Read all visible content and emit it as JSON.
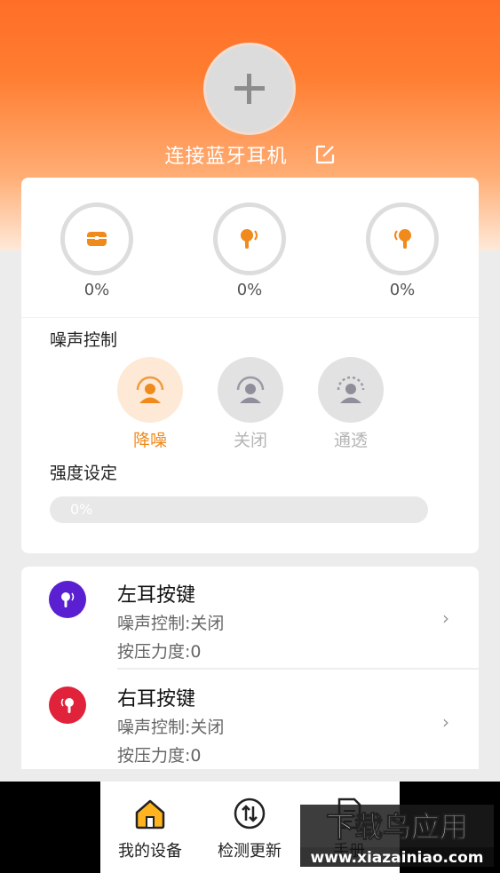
{
  "header": {
    "connect_label": "连接蓝牙耳机",
    "add_icon": "plus-icon",
    "edit_icon": "edit-icon"
  },
  "battery": [
    {
      "name": "case",
      "icon": "case-icon",
      "percent": "0%"
    },
    {
      "name": "left",
      "icon": "left-earbud-icon",
      "percent": "0%"
    },
    {
      "name": "right",
      "icon": "right-earbud-icon",
      "percent": "0%"
    }
  ],
  "noise_control": {
    "title": "噪声控制",
    "modes": [
      {
        "label": "降噪",
        "active": true
      },
      {
        "label": "关闭",
        "active": false
      },
      {
        "label": "通透",
        "active": false
      }
    ]
  },
  "intensity": {
    "title": "强度设定",
    "value_text": "0%",
    "value": 0
  },
  "keys": [
    {
      "title": "左耳按键",
      "noise": "噪声控制:关闭",
      "pressure": "按压力度:0",
      "color": "#5a1fd0"
    },
    {
      "title": "右耳按键",
      "noise": "噪声控制:关闭",
      "pressure": "按压力度:0",
      "color": "#e0223a"
    }
  ],
  "nav": [
    {
      "label": "我的设备",
      "icon": "home-icon",
      "active": true
    },
    {
      "label": "检测更新",
      "icon": "update-icon",
      "active": false
    },
    {
      "label": "手册",
      "icon": "manual-icon",
      "active": false
    }
  ],
  "watermark": {
    "title": "下载鸟应用",
    "url": "www.xiazainiao.com"
  },
  "colors": {
    "accent": "#ff7a2a",
    "inactive": "#b5b5b5"
  }
}
